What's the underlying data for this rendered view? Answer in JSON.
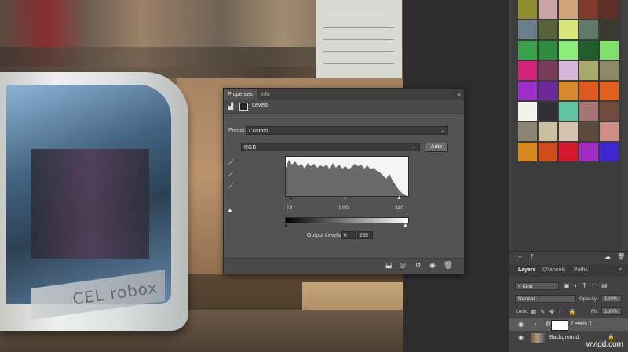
{
  "properties_panel": {
    "tabs": [
      {
        "label": "Properties",
        "active": true
      },
      {
        "label": "Info",
        "active": false
      }
    ],
    "adjustment_name": "Levels",
    "preset_label": "Preset:",
    "preset_value": "Custom",
    "channel_value": "RGB",
    "auto_label": "Auto",
    "input_levels": {
      "black": "13",
      "mid": "1.00",
      "white": "240"
    },
    "output_levels_label": "Output Levels:",
    "output_levels": {
      "black": "0",
      "white": "255"
    }
  },
  "layers_panel": {
    "tabs": [
      {
        "label": "Layers",
        "active": true
      },
      {
        "label": "Channels",
        "active": false
      },
      {
        "label": "Paths",
        "active": false
      }
    ],
    "kind_filter": "Kind",
    "blend_mode": "Normal",
    "opacity_label": "Opacity:",
    "opacity_value": "100%",
    "lock_label": "Lock:",
    "fill_label": "Fill:",
    "fill_value": "100%",
    "layers": [
      {
        "name": "Levels 1",
        "selected": true
      },
      {
        "name": "Background",
        "selected": false
      }
    ]
  },
  "swatches": [
    "#8f8f2f",
    "#c9a4a4",
    "#d0a47b",
    "#7e3a2a",
    "#5e2d26",
    "#6b7e8c",
    "#59623a",
    "#d7e77c",
    "#5f7a68",
    "#3c3a2e",
    "#39a14b",
    "#2f8c3e",
    "#8aed7a",
    "#215e2c",
    "#7ee06b",
    "#d5237a",
    "#7b3a55",
    "#d8b7db",
    "#a7aa6a",
    "#8a8a63",
    "#9d2ec8",
    "#6d2a9b",
    "#d88b2c",
    "#e05a1f",
    "#e2611c",
    "#f3f3ec",
    "#2f2f35",
    "#5fc5a2",
    "#a87672",
    "#6f4c3e",
    "#8c8576",
    "#c9c1a0",
    "#d6c3ad",
    "#5b4a3c",
    "#cf8e85",
    "#d7881c",
    "#d14c1b",
    "#d4172a",
    "#a12cc2",
    "#3d26d1"
  ],
  "watermark": "wvidd.com"
}
